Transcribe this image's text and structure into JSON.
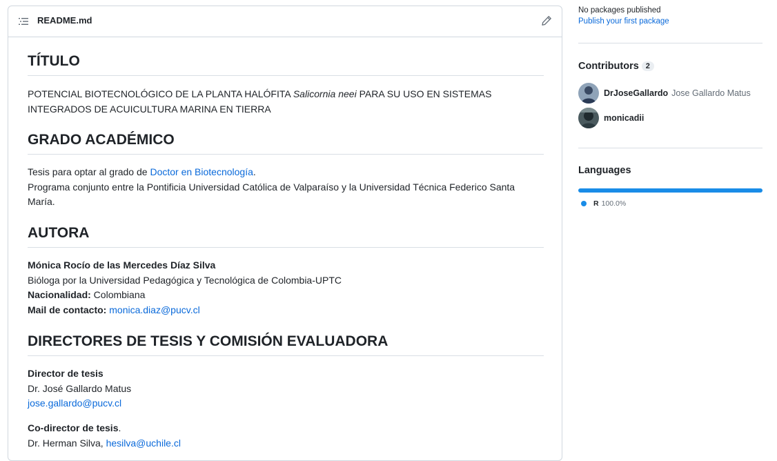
{
  "readme": {
    "filename": "README.md",
    "sections": {
      "titulo": {
        "heading": "TÍTULO",
        "text_before": "POTENCIAL BIOTECNOLÓGICO DE LA PLANTA HALÓFITA ",
        "italic": "Salicornia neei",
        "text_after": " PARA SU USO EN SISTEMAS",
        "line2": "INTEGRADOS DE ACUICULTURA MARINA EN TIERRA"
      },
      "grado": {
        "heading": "GRADO ACADÉMICO",
        "line1_prefix": "Tesis para optar al grado de ",
        "line1_link": "Doctor en Biotecnología",
        "line1_suffix": ".",
        "line2": "Programa conjunto entre la Pontificia Universidad Católica de Valparaíso y la Universidad Técnica Federico Santa",
        "line3": "María."
      },
      "autora": {
        "heading": "AUTORA",
        "name": "Mónica Rocío de las Mercedes Díaz Silva",
        "bio": "Bióloga por la Universidad Pedagógica y Tecnológica de Colombia-UPTC",
        "nationality_label": "Nacionalidad:",
        "nationality_value": " Colombiana",
        "mail_label": "Mail de contacto:",
        "mail_value": "monica.diaz@pucv.cl"
      },
      "directores": {
        "heading": "DIRECTORES DE TESIS Y COMISIÓN EVALUADORA",
        "director_label": "Director de tesis",
        "director_name": "Dr. José Gallardo Matus",
        "director_mail": "jose.gallardo@pucv.cl",
        "codirector_label": "Co-director de tesis",
        "codirector_suffix": ".",
        "codirector_name": "Dr. Herman Silva, ",
        "codirector_mail": "hesilva@uchile.cl"
      }
    }
  },
  "sidebar": {
    "packages": {
      "status": "No packages published",
      "link": "Publish your first package"
    },
    "contributors": {
      "heading": "Contributors",
      "count": "2",
      "people": [
        {
          "login": "DrJoseGallardo",
          "name": "Jose Gallardo Matus"
        },
        {
          "login": "monicadii",
          "name": ""
        }
      ]
    },
    "languages": {
      "heading": "Languages",
      "items": [
        {
          "name": "R",
          "percent": "100.0%",
          "color": "#198CE7"
        }
      ]
    }
  }
}
